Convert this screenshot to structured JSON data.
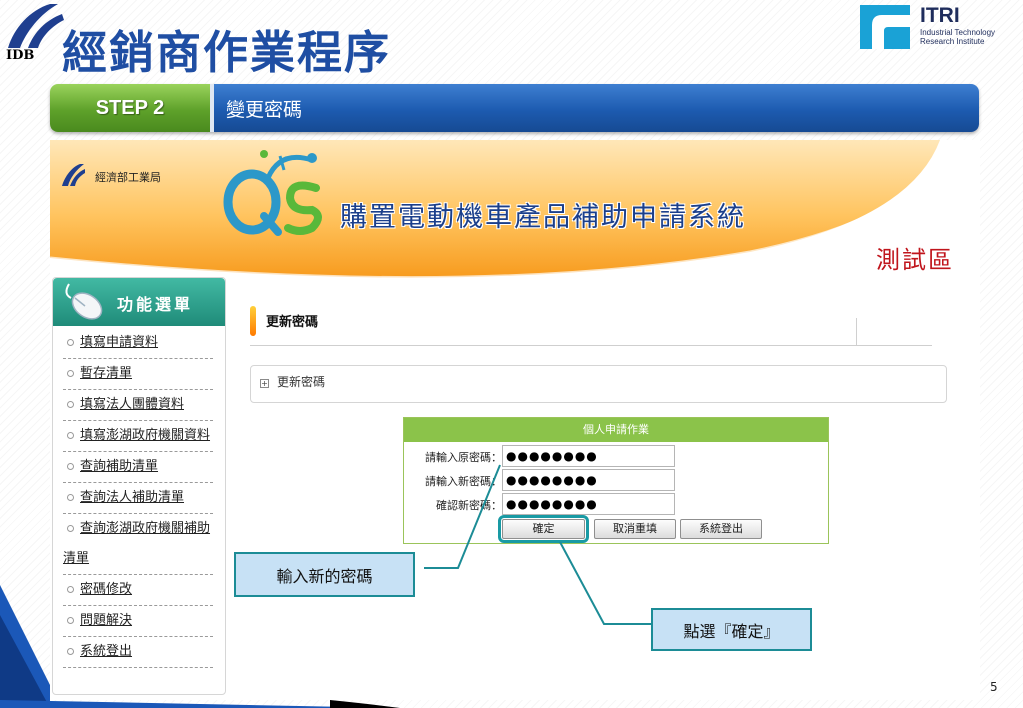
{
  "slide": {
    "title": "經銷商作業程序",
    "idb_logo_text": "IDB",
    "itri_logo": {
      "name": "ITRI",
      "subtitle_line1": "Industrial Technology",
      "subtitle_line2": "Research Institute"
    },
    "page_number": "5"
  },
  "step": {
    "badge": "STEP 2",
    "title": "變更密碼"
  },
  "app": {
    "org_name": "經濟部工業局",
    "system_title": "購置電動機車產品補助申請系統",
    "test_area": "測試區",
    "menu": {
      "title": "功能選單",
      "items": [
        {
          "label": "填寫申請資料"
        },
        {
          "label": "暫存清單"
        },
        {
          "label": "填寫法人團體資料"
        },
        {
          "label": "填寫澎湖政府機關資料"
        },
        {
          "label": "查詢補助清單"
        },
        {
          "label": "查詢法人補助清單"
        },
        {
          "label": "查詢澎湖政府機關補助清單"
        },
        {
          "label": "密碼修改"
        },
        {
          "label": "問題解決"
        },
        {
          "label": "系統登出"
        }
      ]
    },
    "page_heading": "更新密碼",
    "section_label": "更新密碼",
    "form": {
      "header": "個人申請作業",
      "fields": [
        {
          "label": "請輸入原密碼：",
          "value": "●●●●●●●●"
        },
        {
          "label": "請輸入新密碼：",
          "value": "●●●●●●●●"
        },
        {
          "label": "確認新密碼：",
          "value": "●●●●●●●●"
        }
      ],
      "buttons": {
        "confirm": "確定",
        "reset": "取消重填",
        "logout": "系統登出"
      }
    }
  },
  "callouts": {
    "new_password": "輸入新的密碼",
    "click_confirm": "點選『確定』"
  },
  "colors": {
    "title_blue": "#1f4ea3",
    "step_green": "#5ea12a",
    "step_blue": "#1d5bb0",
    "menu_teal": "#1f8b79",
    "form_green": "#8bc34a",
    "callout_border": "#1c8c96",
    "callout_fill": "#c7e1f5",
    "test_red": "#c0151c"
  }
}
